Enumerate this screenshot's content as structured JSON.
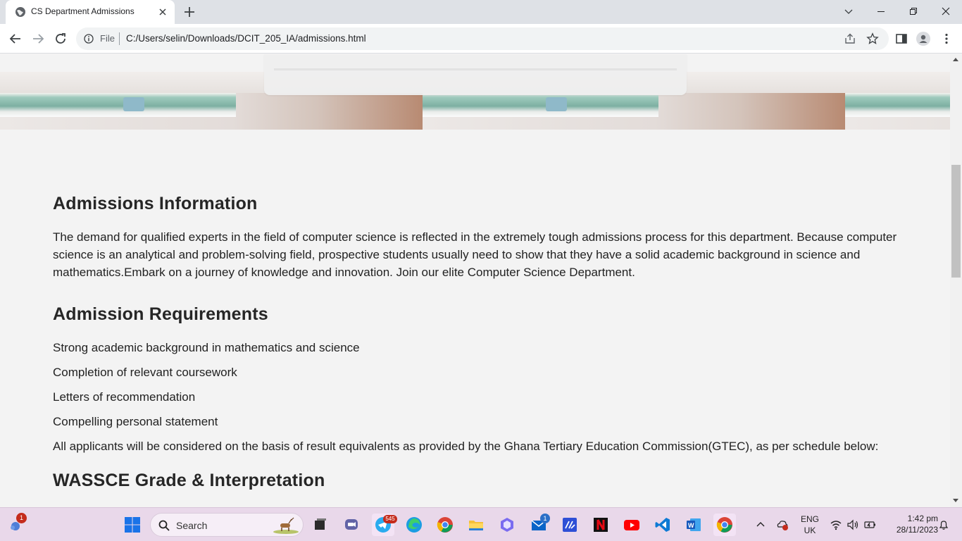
{
  "browser": {
    "tab_title": "CS Department Admissions",
    "url_scheme": "File",
    "url": "C:/Users/selin/Downloads/DCIT_205_IA/admissions.html"
  },
  "page": {
    "admissions_heading": "Admissions Information",
    "admissions_paragraph": "The demand for qualified experts in the field of computer science is reflected in the extremely tough admissions process for this department. Because computer science is an analytical and problem-solving field, prospective students usually need to show that they have a solid academic background in science and mathematics.Embark on a journey of knowledge and innovation. Join our elite Computer Science Department.",
    "requirements_heading": "Admission Requirements",
    "requirements": [
      "Strong academic background in mathematics and science",
      "Completion of relevant coursework",
      "Letters of recommendation",
      "Compelling personal statement"
    ],
    "gtec_note": "All applicants will be considered on the basis of result equivalents as provided by the Ghana Tertiary Education Commission(GTEC), as per schedule below:",
    "wassce_heading": "WASSCE Grade & Interpretation"
  },
  "taskbar": {
    "search_label": "Search",
    "widgets_badge": "1",
    "telegram_badge": "545",
    "mail_badge": "1",
    "language": "ENG",
    "region": "UK",
    "time": "1:42 pm",
    "date": "28/11/2023"
  },
  "colors": {
    "page_bg": "#f3f3f3",
    "heading": "#262626",
    "taskbar_bg": "#e9d8ea",
    "chrome_frame": "#dee1e6"
  }
}
